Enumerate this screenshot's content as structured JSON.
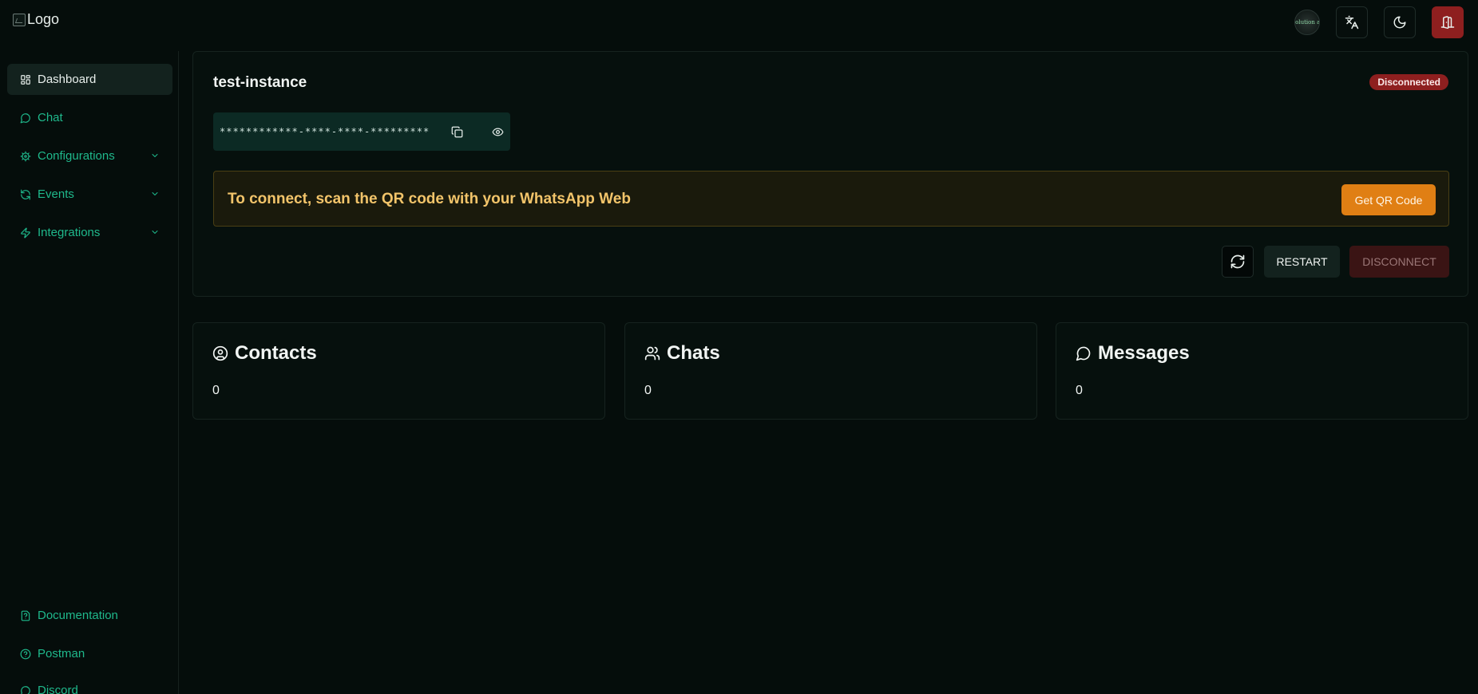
{
  "header": {
    "logo_alt": "Logo",
    "avatar_text": "evolution api",
    "translate_icon": "translate-icon",
    "theme_icon": "moon-icon",
    "logout_icon": "door-exit-icon"
  },
  "sidebar": {
    "items": [
      {
        "label": "Dashboard",
        "icon": "layout-dashboard-icon",
        "active": true
      },
      {
        "label": "Chat",
        "icon": "message-circle-icon"
      },
      {
        "label": "Configurations",
        "icon": "cog-icon",
        "expandable": true
      },
      {
        "label": "Events",
        "icon": "refresh-ccw-dot-icon",
        "expandable": true
      },
      {
        "label": "Integrations",
        "icon": "zap-icon",
        "expandable": true
      }
    ],
    "footer_items": [
      {
        "label": "Documentation",
        "icon": "file-question-icon"
      },
      {
        "label": "Postman",
        "icon": "circle-help-icon"
      },
      {
        "label": "Discord",
        "icon": "message-circle-icon"
      }
    ]
  },
  "instance": {
    "name": "test-instance",
    "status": "Disconnected",
    "token_masked": "************-****-****-************",
    "qr_message": "To connect, scan the QR code with your WhatsApp Web",
    "qr_button": "Get QR Code",
    "restart_label": "RESTART",
    "disconnect_label": "DISCONNECT"
  },
  "stats": [
    {
      "title": "Contacts",
      "value": "0",
      "icon": "circle-user-icon"
    },
    {
      "title": "Chats",
      "value": "0",
      "icon": "users-icon"
    },
    {
      "title": "Messages",
      "value": "0",
      "icon": "message-circle-icon"
    }
  ],
  "colors": {
    "background": "#050d0b",
    "accent": "#1fb98c",
    "danger": "#8e1f1f",
    "warning": "#e07f14",
    "warning_text": "#f2c46a"
  }
}
